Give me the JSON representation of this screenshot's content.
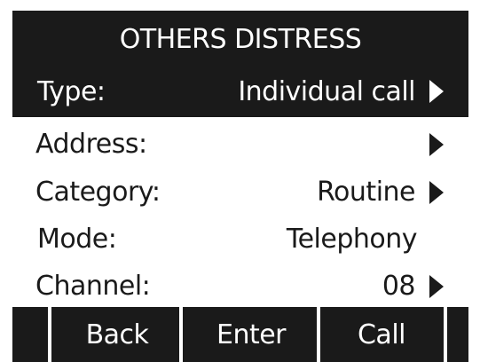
{
  "title": "OTHERS DISTRESS",
  "menu": {
    "rows": [
      {
        "label": "Type:",
        "value": "Individual call",
        "selected": true,
        "has_submenu": true
      },
      {
        "label": "Address:",
        "value": "",
        "selected": false,
        "has_submenu": true
      },
      {
        "label": "Category:",
        "value": "Routine",
        "selected": false,
        "has_submenu": true
      },
      {
        "label": "Mode:",
        "value": "Telephony",
        "selected": false,
        "has_submenu": false
      },
      {
        "label": "Channel:",
        "value": "08",
        "selected": false,
        "has_submenu": true
      }
    ]
  },
  "softkeys": {
    "back": "Back",
    "enter": "Enter",
    "call": "Call"
  },
  "colors": {
    "background": "#ffffff",
    "inverse": "#1a1a1a",
    "text": "#1a1a1a",
    "inverse_text": "#ffffff"
  },
  "icons": {
    "submenu": "triangle-right-icon"
  }
}
